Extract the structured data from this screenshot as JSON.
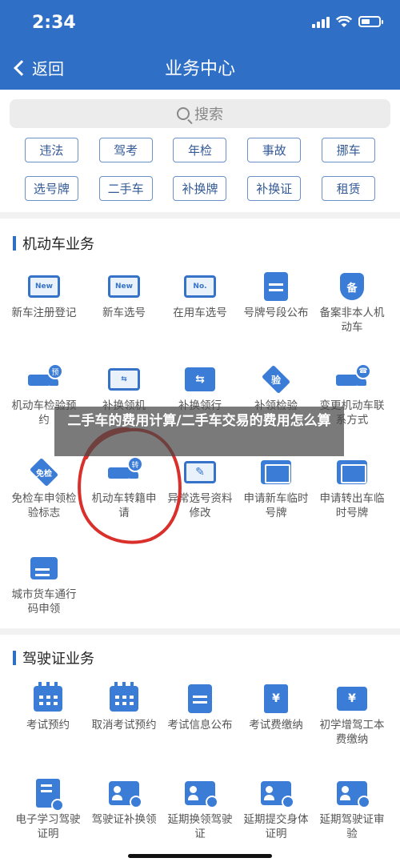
{
  "status": {
    "time": "2:34"
  },
  "nav": {
    "back_label": "返回",
    "title": "业务中心"
  },
  "search": {
    "placeholder": "搜索"
  },
  "quick_chips": [
    [
      "违法",
      "驾考",
      "年检",
      "事故",
      "挪车"
    ],
    [
      "选号牌",
      "二手车",
      "补换牌",
      "补换证",
      "租赁"
    ]
  ],
  "sections": {
    "vehicle": {
      "title": "机动车业务",
      "items": [
        {
          "label": "新车注册登记",
          "icon": "new-card-check-icon",
          "icon_text": "New"
        },
        {
          "label": "新车选号",
          "icon": "new-card-icon",
          "icon_text": "New"
        },
        {
          "label": "在用车选号",
          "icon": "number-card-icon",
          "icon_text": "No."
        },
        {
          "label": "号牌号段公布",
          "icon": "document-announce-icon",
          "icon_text": ""
        },
        {
          "label": "备案非本人机动车",
          "icon": "shield-record-icon",
          "icon_text": "备"
        },
        {
          "label": "机动车检验预约",
          "icon": "truck-appointment-icon",
          "icon_text": "预"
        },
        {
          "label": "补换领机",
          "icon": "exchange-card-icon",
          "icon_text": "⇆"
        },
        {
          "label": "补换领行",
          "icon": "exchange-vehicle-icon",
          "icon_text": "⇆"
        },
        {
          "label": "补领检验",
          "icon": "inspection-diamond-icon",
          "icon_text": "验"
        },
        {
          "label": "变更机动车联系方式",
          "icon": "truck-phone-icon",
          "icon_text": "☎"
        },
        {
          "label": "免检车申领检验标志",
          "icon": "exempt-diamond-icon",
          "icon_text": "免检"
        },
        {
          "label": "机动车转籍申请",
          "icon": "truck-transfer-icon",
          "icon_text": "转"
        },
        {
          "label": "异常选号资料修改",
          "icon": "edit-screen-icon",
          "icon_text": "✎"
        },
        {
          "label": "申请新车临时号牌",
          "icon": "temp-plate-icon",
          "icon_text": ""
        },
        {
          "label": "申请转出车临时号牌",
          "icon": "temp-plate-out-icon",
          "icon_text": ""
        },
        {
          "label": "城市货车通行码申领",
          "icon": "cargo-truck-icon",
          "icon_text": ""
        }
      ]
    },
    "license": {
      "title": "驾驶证业务",
      "items": [
        {
          "label": "考试预约",
          "icon": "exam-calendar-icon"
        },
        {
          "label": "取消考试预约",
          "icon": "cancel-calendar-icon"
        },
        {
          "label": "考试信息公布",
          "icon": "exam-info-icon"
        },
        {
          "label": "考试费缴纳",
          "icon": "fee-receipt-icon",
          "icon_text": "¥"
        },
        {
          "label": "初学增驾工本费缴纳",
          "icon": "cost-fee-icon",
          "icon_text": "¥"
        },
        {
          "label": "电子学习驾驶证明",
          "icon": "e-learning-icon"
        },
        {
          "label": "驾驶证补换领",
          "icon": "license-replace-icon"
        },
        {
          "label": "延期换领驾驶证",
          "icon": "delay-renew-icon"
        },
        {
          "label": "延期提交身体证明",
          "icon": "delay-health-icon"
        },
        {
          "label": "延期驾驶证审验",
          "icon": "delay-review-icon"
        }
      ]
    }
  },
  "overlay": {
    "caption": "二手车的费用计算/二手车交易的费用怎么算"
  },
  "colors": {
    "header": "#2f6fc6",
    "icon": "#3a7cd6",
    "chip_border": "#6a92c8",
    "annotation": "#d9302c"
  }
}
